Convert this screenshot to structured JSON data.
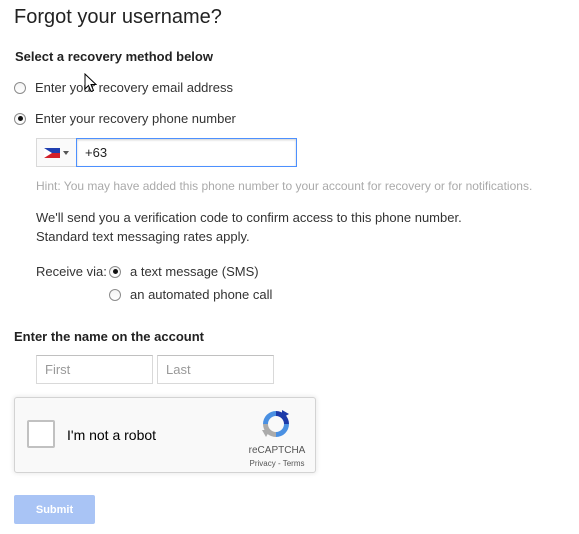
{
  "page": {
    "title": "Forgot your username?"
  },
  "recovery": {
    "heading": "Select a recovery method below",
    "options": [
      {
        "label": "Enter your recovery email address",
        "selected": false
      },
      {
        "label": "Enter your recovery phone number",
        "selected": true
      }
    ]
  },
  "phone": {
    "country_flag": "philippines-flag",
    "value": "+63",
    "hint": "Hint: You may have added this phone number to your account for recovery or for notifications.",
    "info_line1": "We'll send you a verification code to confirm access to this phone number.",
    "info_line2": "Standard text messaging rates apply."
  },
  "receive": {
    "label": "Receive via:",
    "options": [
      {
        "label": "a text message (SMS)",
        "selected": true
      },
      {
        "label": "an automated phone call",
        "selected": false
      }
    ]
  },
  "name": {
    "heading": "Enter the name on the account",
    "first_placeholder": "First",
    "last_placeholder": "Last"
  },
  "recaptcha": {
    "label": "I'm not a robot",
    "brand": "reCAPTCHA",
    "privacy": "Privacy",
    "separator": " - ",
    "terms": "Terms"
  },
  "submit": {
    "label": "Submit"
  },
  "colors": {
    "focus_border": "#4d90fe",
    "submit_disabled": "#a9c4f5",
    "hint_text": "#aaaaaa"
  }
}
